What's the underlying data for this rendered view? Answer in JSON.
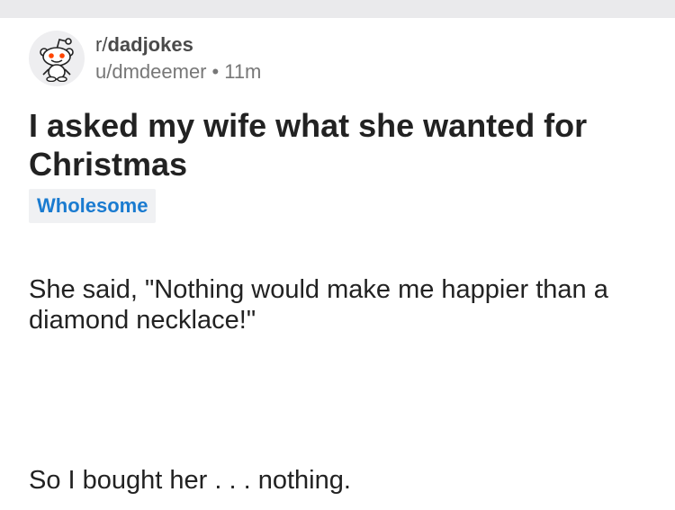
{
  "post": {
    "subreddit": "r/dadjokes",
    "subreddit_prefix": "r/",
    "subreddit_name": "dadjokes",
    "user": "u/dmdeemer",
    "separator": "•",
    "age": "11m",
    "title": "I asked my wife what she wanted for Christmas",
    "flair": "Wholesome",
    "paragraphs": [
      "She said, \"Nothing would make me happier than a diamond necklace!\"",
      "So I bought her . . . nothing."
    ]
  },
  "colors": {
    "flair_text": "#1a7bd0",
    "flair_bg": "#f0f1f3",
    "title": "#222222",
    "topbar": "#eaeaec"
  },
  "icons": {
    "avatar": "snoo-icon"
  }
}
